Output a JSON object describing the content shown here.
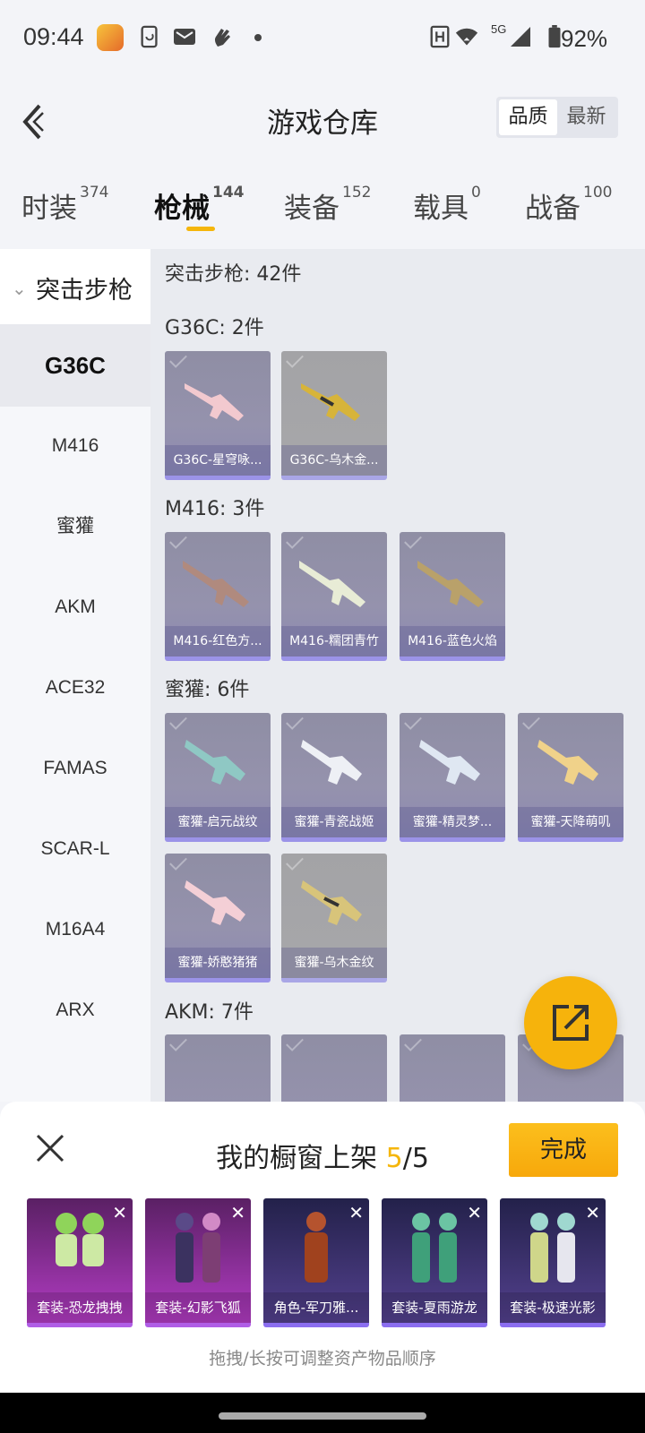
{
  "status_bar": {
    "time": "09:44",
    "network": "5G",
    "battery": "92%",
    "icons": [
      "app-badge-icon",
      "screenshot-icon",
      "mail-icon",
      "gesture-icon",
      "dot-icon",
      "nfc-icon",
      "wifi-icon",
      "signal-icon",
      "battery-icon"
    ]
  },
  "header": {
    "title": "游戏仓库",
    "sort_options": [
      "品质",
      "最新"
    ],
    "sort_selected": "品质"
  },
  "tabs": [
    {
      "label": "时装",
      "count": "374"
    },
    {
      "label": "枪械",
      "count": "144",
      "active": true
    },
    {
      "label": "装备",
      "count": "152"
    },
    {
      "label": "载具",
      "count": "0"
    },
    {
      "label": "战备",
      "count": "100"
    }
  ],
  "sidebar": {
    "category": "突击步枪",
    "items": [
      "G36C",
      "M416",
      "蜜獾",
      "AKM",
      "ACE32",
      "FAMAS",
      "SCAR-L",
      "M16A4",
      "ARX"
    ],
    "selected": "G36C"
  },
  "content": {
    "summary": "突击步枪: 42件",
    "groups": [
      {
        "title": "G36C: 2件",
        "items": [
          "G36C-星穹咏...",
          "G36C-乌木金..."
        ]
      },
      {
        "title": "M416: 3件",
        "items": [
          "M416-红色方...",
          "M416-糯团青竹",
          "M416-蓝色火焰"
        ]
      },
      {
        "title": "蜜獾: 6件",
        "items": [
          "蜜獾-启元战纹",
          "蜜獾-青瓷战姬",
          "蜜獾-精灵梦...",
          "蜜獾-天降萌叽",
          "蜜獾-娇憨猪猪",
          "蜜獾-乌木金纹"
        ]
      },
      {
        "title": "AKM: 7件",
        "items": [
          "",
          "",
          "",
          ""
        ]
      }
    ]
  },
  "showcase": {
    "title_prefix": "我的橱窗上架",
    "count": "5",
    "total": "/5",
    "done_label": "完成",
    "slots": [
      "套装-恐龙拽拽",
      "套装-幻影飞狐",
      "角色-军刀雅...",
      "套装-夏雨游龙",
      "套装-极速光影"
    ],
    "hint": "拖拽/长按可调整资产物品顺序"
  },
  "colors": {
    "accent": "#f5b60c",
    "card": "#9592ad",
    "slot_purple": "#b33cc4",
    "slot_navy": "#54418f"
  }
}
